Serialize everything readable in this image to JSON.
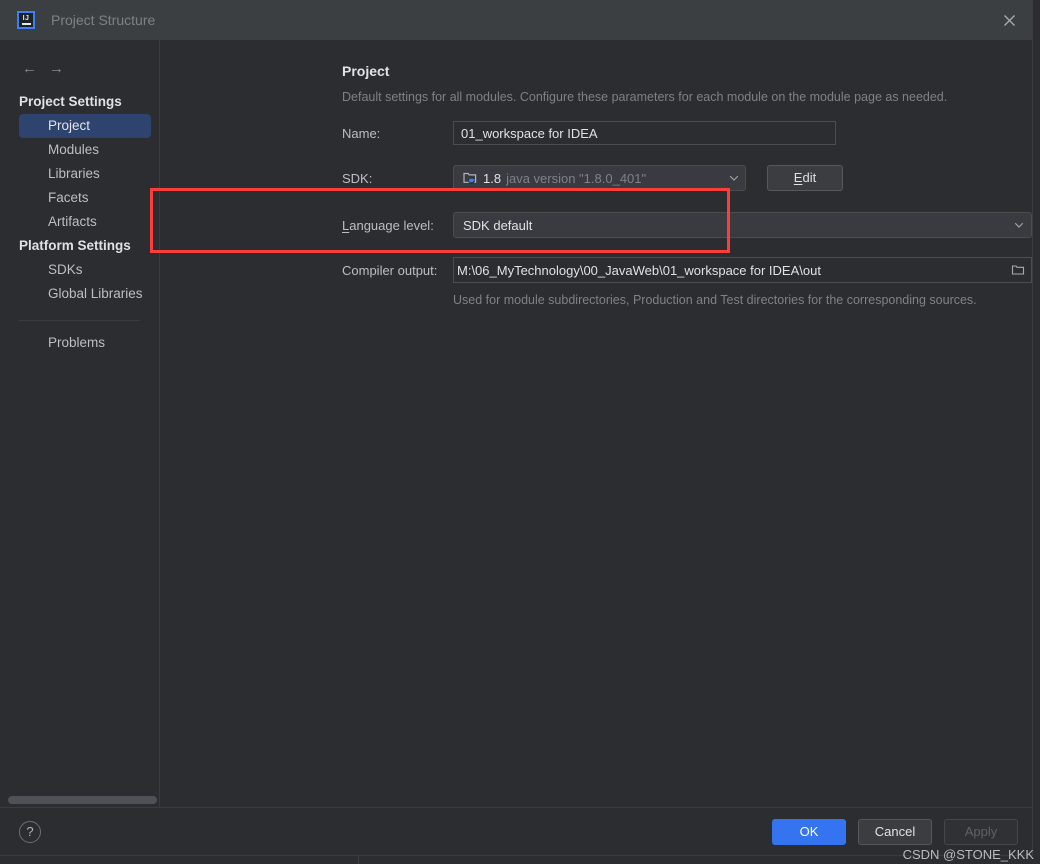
{
  "window": {
    "title": "Project Structure",
    "logo_icon": "intellij-idea-logo",
    "close_icon": "close-icon"
  },
  "sidebar": {
    "back_icon": "arrow-left-icon",
    "forward_icon": "arrow-right-icon",
    "groups": [
      {
        "header": "Project Settings",
        "items": [
          {
            "label": "Project",
            "selected": true
          },
          {
            "label": "Modules",
            "selected": false
          },
          {
            "label": "Libraries",
            "selected": false
          },
          {
            "label": "Facets",
            "selected": false
          },
          {
            "label": "Artifacts",
            "selected": false
          }
        ]
      },
      {
        "header": "Platform Settings",
        "items": [
          {
            "label": "SDKs",
            "selected": false
          },
          {
            "label": "Global Libraries",
            "selected": false
          }
        ]
      }
    ],
    "problems_label": "Problems"
  },
  "content": {
    "title": "Project",
    "description": "Default settings for all modules. Configure these parameters for each module on the module page as needed.",
    "name": {
      "label": "Name:",
      "value": "01_workspace for IDEA",
      "placeholder": ""
    },
    "sdk": {
      "label": "SDK:",
      "icon": "jdk-icon",
      "version": "1.8",
      "description": "java version \"1.8.0_401\"",
      "chevron_icon": "chevron-down-icon",
      "edit_button": {
        "mnemonic": "E",
        "rest": "dit"
      }
    },
    "language_level": {
      "label_mnemonic": "L",
      "label_rest": "anguage level:",
      "value": "SDK default",
      "chevron_icon": "chevron-down-icon"
    },
    "compiler_output": {
      "label": "Compiler output:",
      "value": "M:\\06_MyTechnology\\00_JavaWeb\\01_workspace for IDEA\\out",
      "browse_icon": "folder-icon",
      "hint": "Used for module subdirectories, Production and Test directories for the corresponding sources."
    }
  },
  "annotation": {
    "color": "#fc3d39"
  },
  "footer": {
    "help_label": "?",
    "help_icon": "help-icon",
    "ok_label": "OK",
    "cancel_label": "Cancel",
    "apply_label": "Apply",
    "ok_color": "#3574f0"
  },
  "watermark": {
    "text": "CSDN @STONE_KKK"
  }
}
